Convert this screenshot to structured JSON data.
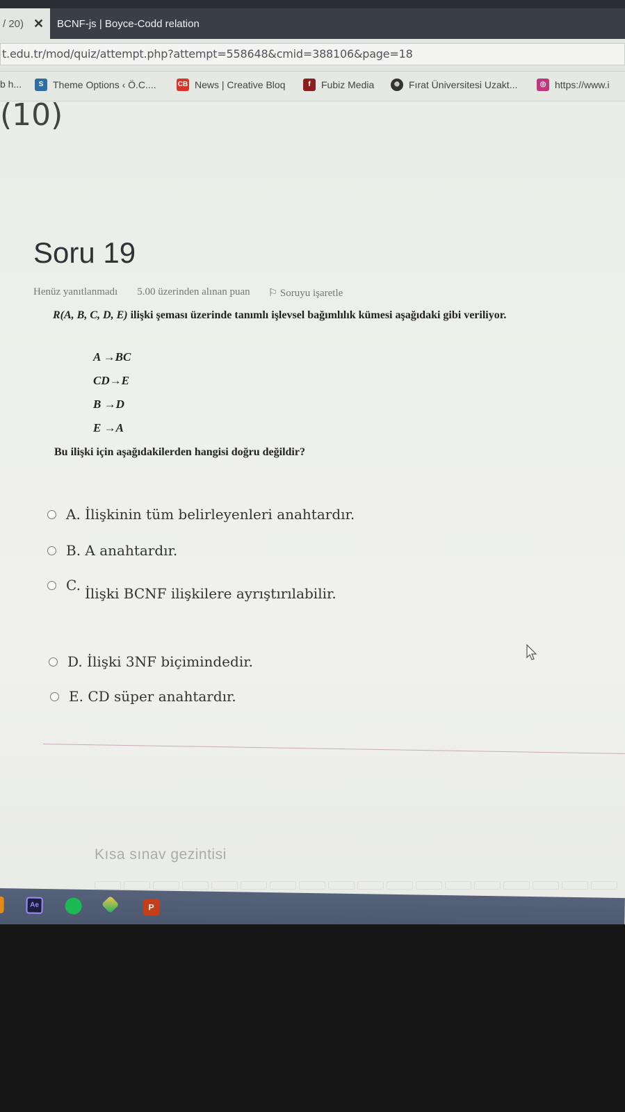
{
  "browser": {
    "tabs": [
      {
        "label": "/ 20)",
        "close": "✕"
      },
      {
        "label": "BCNF-js | Boyce-Codd relation"
      }
    ],
    "url": "t.edu.tr/mod/quiz/attempt.php?attempt=558648&cmid=388106&page=18",
    "bookmarks": [
      {
        "label": "b h..."
      },
      {
        "label": "Theme Options ‹ Ö.C...."
      },
      {
        "label": "News | Creative Bloq"
      },
      {
        "label": "Fubiz Media"
      },
      {
        "label": "Fırat Üniversitesi Uzakt..."
      },
      {
        "label": "https://www.i"
      }
    ]
  },
  "page": {
    "prev_heading_partial": "(10)",
    "question_title": "Soru 19",
    "status": "Henüz yanıtlanmadı",
    "points": "5.00 üzerinden alınan puan",
    "flag_label": "Soruyu işaretle",
    "question_text_prefix": "R(A, B, C, D, E)",
    "question_text_rest": " ilişki şeması üzerinde tanımlı işlevsel bağımlılık kümesi aşağıdaki gibi veriliyor.",
    "fds": [
      "A →BC",
      "CD→E",
      "B →D",
      "E →A"
    ],
    "sub_question": "Bu ilişki için aşağıdakilerden hangisi doğru değildir?",
    "options": [
      {
        "letter": "A.",
        "text": "İlişkinin tüm belirleyenleri anahtardır."
      },
      {
        "letter": "B.",
        "text": "A anahtardır."
      },
      {
        "letter": "C.",
        "text": "İlişki BCNF ilişkilere ayrıştırılabilir."
      },
      {
        "letter": "D.",
        "text": "İlişki 3NF biçimindedir."
      },
      {
        "letter": "E.",
        "text": "CD süper anahtardır."
      }
    ],
    "nav_title": "Kısa sınav gezintisi"
  },
  "taskbar": {
    "icons": [
      "ae-icon",
      "spotify-icon",
      "app-icon",
      "powerpoint-icon"
    ]
  },
  "colors": {
    "tabstrip": "#3a3f47",
    "taskbar": "#4f5b72",
    "accent_divider": "#c9a9b8"
  }
}
